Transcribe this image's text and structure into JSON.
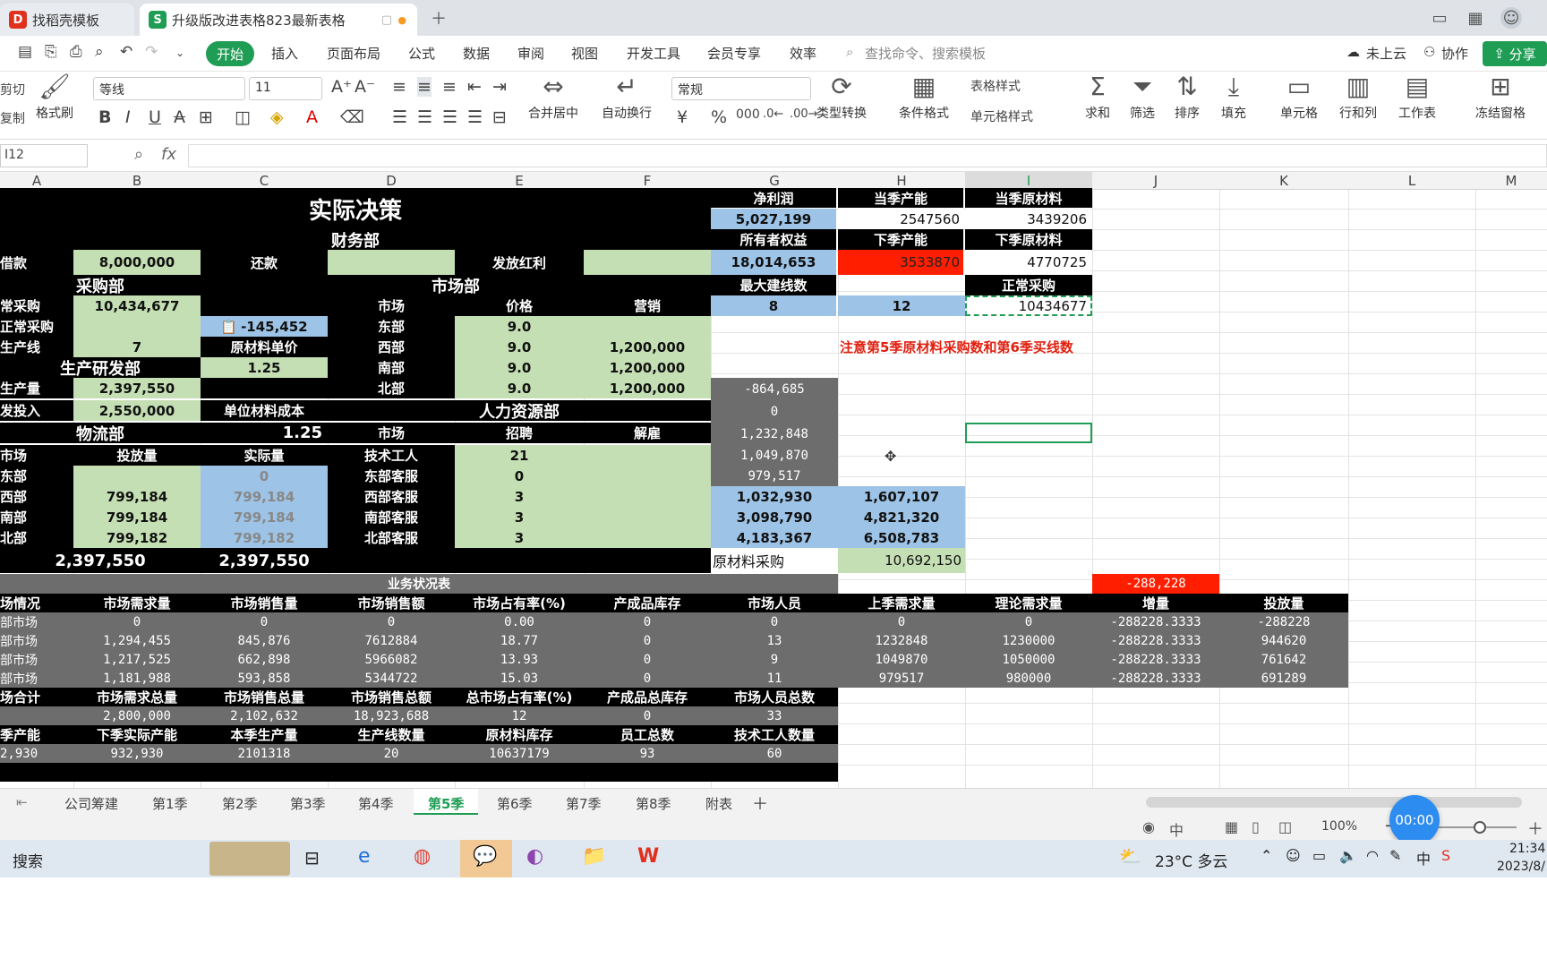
{
  "browser_tabs": [
    {
      "label": "找稻壳模板",
      "icon": "D"
    },
    {
      "label": "升级版改进表格823最新表格",
      "icon": "S"
    }
  ],
  "menu": {
    "start": "开始",
    "items": [
      "插入",
      "页面布局",
      "公式",
      "数据",
      "审阅",
      "视图",
      "开发工具",
      "会员专享",
      "效率"
    ],
    "search_placeholder": "查找命令、搜索模板",
    "cloud": "未上云",
    "collab": "协作",
    "share": "分享"
  },
  "ribbon": {
    "cut": "剪切",
    "copy": "复制",
    "format_painter": "格式刷",
    "font": "等线",
    "size": "11",
    "num_format": "常规",
    "merge": "合并居中",
    "wrap": "自动换行",
    "type_convert": "类型转换",
    "cond_format": "条件格式",
    "table_style": "表格样式",
    "cell_style": "单元格样式",
    "sum": "求和",
    "filter": "筛选",
    "sort": "排序",
    "fill": "填充",
    "cell": "单元格",
    "rowcol": "行和列",
    "worksheet": "工作表",
    "freeze": "冻结窗格"
  },
  "formula": {
    "cell_ref": "I12",
    "fx": "fx",
    "content": ""
  },
  "columns": [
    "A",
    "B",
    "C",
    "D",
    "E",
    "F",
    "G",
    "H",
    "I",
    "J",
    "K",
    "L",
    "M"
  ],
  "cells": {
    "title": "实际决策",
    "finance": "财务部",
    "loan": "借款",
    "loan_v": "8,000,000",
    "repay": "还款",
    "dividend": "发放红利",
    "net_profit": "净利润",
    "net_profit_v": "5,027,199",
    "cur_cap": "当季产能",
    "cur_cap_v": "2547560",
    "cur_mat": "当季原材料",
    "cur_mat_v": "3439206",
    "equity": "所有者权益",
    "equity_v": "18,014,653",
    "next_cap": "下季产能",
    "next_cap_v": "3533870",
    "next_mat": "下季原材料",
    "next_mat_v": "4770725",
    "purchase_dept": "采购部",
    "market_dept": "市场部",
    "max_lines": "最大建线数",
    "max_lines_v1": "8",
    "max_lines_v2": "12",
    "normal_buy": "正常采购",
    "normal_buy_v": "10434677",
    "buy1": "常采购",
    "buy1_v": "10,434,677",
    "market": "市场",
    "price": "价格",
    "marketing": "营销",
    "buy2": "正常采购",
    "buy2_v": "-145,452",
    "east": "东部",
    "east_p": "9.0",
    "line": "生产线",
    "line_v": "7",
    "mat_price": "原材料单价",
    "west": "西部",
    "west_p": "9.0",
    "west_m": "1,200,000",
    "note": "注意第5季原材料采购数和第6季买线数",
    "rd_dept": "生产研发部",
    "mat_price_v": "1.25",
    "south": "南部",
    "south_p": "9.0",
    "south_m": "1,200,000",
    "prod": "生产量",
    "prod_v": "2,397,550",
    "north": "北部",
    "north_p": "9.0",
    "north_m": "1,200,000",
    "g_a": "-864,685",
    "rd_in": "发投入",
    "rd_in_v": "2,550,000",
    "unit_cost": "单位材料成本",
    "hr": "人力资源部",
    "g_b": "0",
    "logistics": "物流部",
    "unit_cost_v": "1.25",
    "market2": "市场",
    "hire": "招聘",
    "fire": "解雇",
    "g_c": "1,232,848",
    "lm": "市场",
    "put": "投放量",
    "actual": "实际量",
    "tech": "技术工人",
    "tech_v": "21",
    "g_d": "1,049,870",
    "le": "东部",
    "le_a": "0",
    "es": "东部客服",
    "es_v": "0",
    "g_e": "979,517",
    "lw": "西部",
    "lw_p": "799,184",
    "lw_a": "799,184",
    "ws": "西部客服",
    "ws_v": "3",
    "g_f": "1,032,930",
    "h_f": "1,607,107",
    "ls": "南部",
    "ls_p": "799,184",
    "ls_a": "799,184",
    "ss": "南部客服",
    "ss_v": "3",
    "g_g": "3,098,790",
    "h_g": "4,821,320",
    "ln": "北部",
    "ln_p": "799,182",
    "ln_a": "799,182",
    "ns": "北部客服",
    "ns_v": "3",
    "g_h": "4,183,367",
    "h_h": "6,508,783",
    "tot1": "2,397,550",
    "tot2": "2,397,550",
    "raw_buy": "原材料采购",
    "raw_buy_v": "10,692,150",
    "biz": "业务状况表",
    "j_red": "-288,228"
  },
  "biz_header": [
    "场情况",
    "市场需求量",
    "市场销售量",
    "市场销售额",
    "市场占有率(%)",
    "产成品库存",
    "市场人员",
    "上季需求量",
    "理论需求量",
    "增量",
    "投放量"
  ],
  "biz_rows": [
    [
      "部市场",
      "0",
      "0",
      "0",
      "0.00",
      "0",
      "0",
      "0",
      "0",
      "-288228.3333",
      "-288228"
    ],
    [
      "部市场",
      "1,294,455",
      "845,876",
      "7612884",
      "18.77",
      "0",
      "13",
      "1232848",
      "1230000",
      "-288228.3333",
      "944620"
    ],
    [
      "部市场",
      "1,217,525",
      "662,898",
      "5966082",
      "13.93",
      "0",
      "9",
      "1049870",
      "1050000",
      "-288228.3333",
      "761642"
    ],
    [
      "部市场",
      "1,181,988",
      "593,858",
      "5344722",
      "15.03",
      "0",
      "11",
      "979517",
      "980000",
      "-288228.3333",
      "691289"
    ]
  ],
  "sum_header": [
    "场合计",
    "市场需求总量",
    "市场销售总量",
    "市场销售总额",
    "总市场占有率(%)",
    "产成品总库存",
    "市场人员总数"
  ],
  "sum_row": [
    "",
    "2,800,000",
    "2,102,632",
    "18,923,688",
    "12",
    "0",
    "33"
  ],
  "cap_header": [
    "季产能",
    "下季实际产能",
    "本季生产量",
    "生产线数量",
    "原材料库存",
    "员工总数",
    "技术工人数量"
  ],
  "cap_row": [
    "2,930",
    "932,930",
    "2101318",
    "20",
    "10637179",
    "93",
    "60"
  ],
  "sheet_tabs": [
    "公司筹建",
    "第1季",
    "第2季",
    "第3季",
    "第4季",
    "第5季",
    "第6季",
    "第7季",
    "第8季",
    "附表"
  ],
  "active_tab": "第5季",
  "zoom": "100%",
  "timer": "00:00",
  "taskbar": {
    "search": "搜索",
    "weather": "23°C 多云",
    "time": "21:34",
    "date": "2023/8/"
  }
}
